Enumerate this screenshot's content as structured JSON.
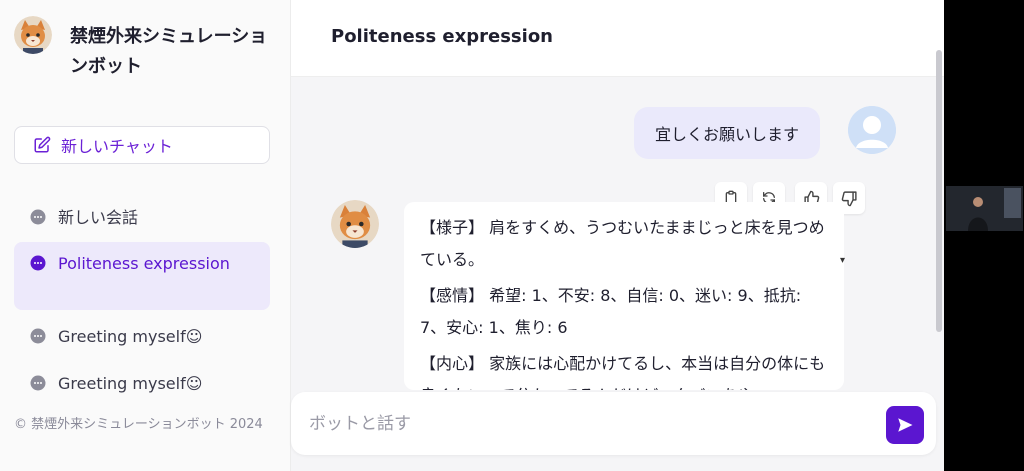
{
  "app": {
    "title": "禁煙外来シミュレーションボット",
    "new_chat_label": "新しいチャット",
    "footer": "© 禁煙外来シミュレーションボット 2024"
  },
  "sidebar": {
    "items": [
      {
        "label": "新しい会話",
        "active": false
      },
      {
        "label": "Politeness expression",
        "active": true
      },
      {
        "label": "Greeting myself☺",
        "active": false
      },
      {
        "label": "Greeting myself☺",
        "active": false
      }
    ]
  },
  "chat": {
    "title": "Politeness expression",
    "user_message": "宜しくお願いします",
    "bot_message": {
      "p1": "【様子】 肩をすくめ、うつむいたままじっと床を見つめている。",
      "p2": "【感情】 希望: 1、不安: 8、自信: 0、迷い: 9、抵抗: 7、安心: 1、焦り: 6",
      "p3": "【内心】 家族には心配かけてるし、本当は自分の体にも良くないって分かってるんだけど...タバコをや"
    },
    "input_placeholder": "ボットと話す"
  },
  "icons": {
    "copy": "clipboard-icon",
    "regenerate": "refresh-icon",
    "like": "thumbs-up-icon",
    "dislike": "thumbs-down-icon",
    "send": "send-icon",
    "new_chat": "edit-icon",
    "conversation": "chat-bubble-icon"
  },
  "colors": {
    "accent": "#5b16d0",
    "active_bg": "#ede9fb",
    "user_bubble": "#eae9fb"
  }
}
